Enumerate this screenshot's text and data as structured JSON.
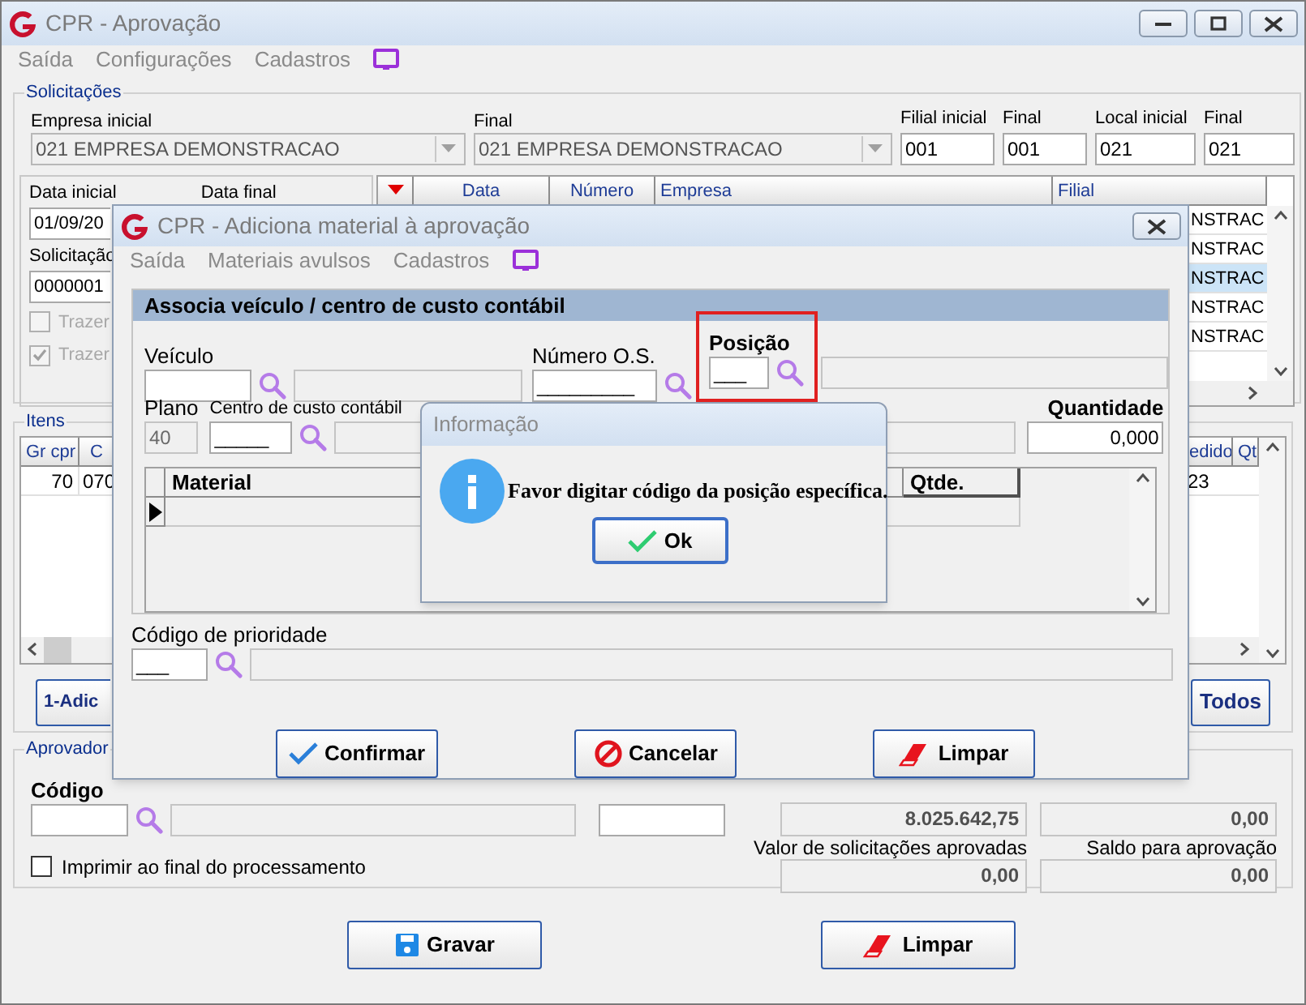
{
  "window": {
    "title": "CPR - Aprovação",
    "menu": [
      "Saída",
      "Configurações",
      "Cadastros"
    ]
  },
  "solicitacoes": {
    "title": "Solicitações",
    "fields": [
      {
        "label": "Empresa inicial",
        "value": "021 EMPRESA DEMONSTRACAO",
        "kind": "combo"
      },
      {
        "label": "Final",
        "value": "021 EMPRESA DEMONSTRACAO",
        "kind": "combo"
      },
      {
        "label": "Filial inicial",
        "value": "001",
        "kind": "text"
      },
      {
        "label": "Final",
        "value": "001",
        "kind": "text"
      },
      {
        "label": "Local inicial",
        "value": "021",
        "kind": "text"
      },
      {
        "label": "Final",
        "value": "021",
        "kind": "text"
      }
    ]
  },
  "filters": {
    "data_inicial_label": "Data inicial",
    "data_inicial": "01/09/20",
    "data_final_label": "Data final",
    "solicitacao_label": "Solicitação",
    "solicitacao": "0000001",
    "checkboxes": [
      {
        "label": "Trazer",
        "checked": false,
        "disabled": true
      },
      {
        "label": "Trazer",
        "checked": true,
        "disabled": true
      }
    ]
  },
  "requests_table": {
    "columns": [
      "Data",
      "Número",
      "Empresa",
      "Filial"
    ],
    "rows": [
      {
        "text": "NSTRAC",
        "selected": false
      },
      {
        "text": "NSTRAC",
        "selected": false
      },
      {
        "text": "NSTRAC",
        "selected": true
      },
      {
        "text": "NSTRAC",
        "selected": false
      },
      {
        "text": "NSTRAC",
        "selected": false
      }
    ]
  },
  "itens": {
    "title": "Itens",
    "columns": [
      "Gr cpr",
      "C"
    ],
    "row": [
      "70",
      "070"
    ],
    "right_columns": [
      "edido",
      "Qt"
    ],
    "right_row": [
      "23"
    ],
    "buttons": [
      "1-Adic",
      "Todos"
    ]
  },
  "aprovador": {
    "title": "Aprovador",
    "codigo_label": "Código",
    "imprimir": {
      "label": "Imprimir ao final do processamento",
      "checked": false
    },
    "totals": [
      {
        "value": "8.025.642,75"
      },
      {
        "value": "0,00"
      },
      {
        "label": "Valor de solicitações aprovadas",
        "value": "0,00"
      },
      {
        "label": "Saldo para aprovação",
        "value": "0,00"
      }
    ]
  },
  "footer_buttons": [
    {
      "label": "Gravar",
      "kind": "save"
    },
    {
      "label": "Limpar",
      "kind": "clear"
    }
  ],
  "dialog": {
    "title": "CPR - Adiciona material à aprovação",
    "menu": [
      "Saída",
      "Materiais avulsos",
      "Cadastros"
    ],
    "section": "Associa veículo / centro de custo contábil",
    "veiculo_label": "Veículo",
    "os_label": "Número O.S.",
    "os_value": "_________",
    "posicao_label": "Posição",
    "posicao_value": "___",
    "posicao_highlighted": true,
    "plano_label": "Plano",
    "plano_value": "40",
    "centro_label": "Centro de custo contábil",
    "centro_value": "_____",
    "quantidade_label": "Quantidade",
    "quantidade_value": "0,000",
    "grid_columns": [
      "Material",
      "Qtde."
    ],
    "prioridade_label": "Código de prioridade",
    "prioridade_value": "___",
    "buttons": [
      {
        "label": "Confirmar",
        "kind": "confirm"
      },
      {
        "label": "Cancelar",
        "kind": "cancel"
      },
      {
        "label": "Limpar",
        "kind": "clear"
      }
    ]
  },
  "message": {
    "title": "Informação",
    "text": "Favor digitar código da posição específica.",
    "button": "Ok"
  }
}
